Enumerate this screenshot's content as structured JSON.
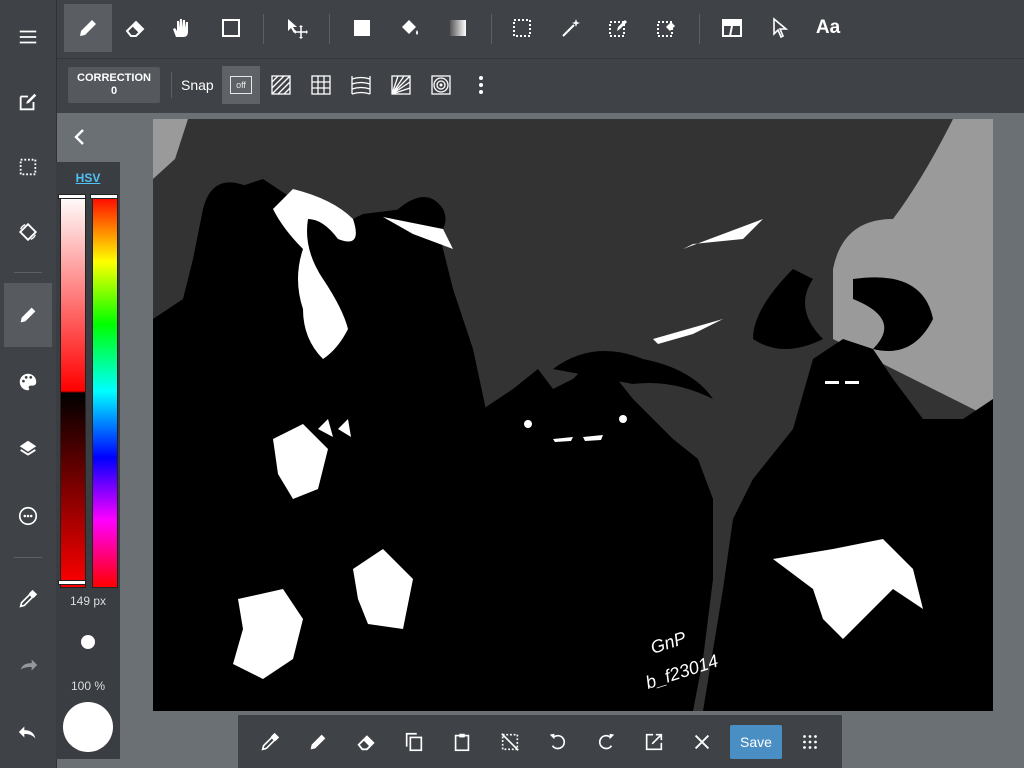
{
  "top_toolbar": {
    "tools": [
      "pen-icon",
      "eraser-icon",
      "hand-icon",
      "rectangle-shape-icon",
      "move-icon",
      "fill-rect-icon",
      "bucket-icon",
      "gradient-icon",
      "select-rect-icon",
      "magic-wand-icon",
      "select-pen-icon",
      "select-eraser-icon",
      "frame-icon",
      "pointer-icon",
      "text-icon"
    ],
    "text_tool_label": "Aa",
    "active_tool": "pen-icon"
  },
  "sub_toolbar": {
    "correction_label": "CORRECTION",
    "correction_value": "0",
    "snap_label": "Snap",
    "snap_off_label": "off",
    "snap_modes": [
      "parallel-lines-icon",
      "grid-icon",
      "curve-icon",
      "radial-icon",
      "concentric-icon",
      "more-icon"
    ]
  },
  "left_toolbar": {
    "items": [
      "menu-icon",
      "edit-icon",
      "selection-icon",
      "transform-icon",
      "brush-icon",
      "palette-icon",
      "layers-icon",
      "material-icon",
      "eyedropper-icon",
      "redo-icon",
      "undo-icon"
    ],
    "active": "brush-icon"
  },
  "color_panel": {
    "mode_label": "HSV",
    "brush_size": "149 px",
    "opacity": "100 %",
    "current_color": "#ffffff"
  },
  "canvas": {
    "background": "#333333",
    "signature_line1": "GnP",
    "signature_line2": "b_f23014"
  },
  "bottom_toolbar": {
    "items": [
      "eyedropper-icon",
      "pen-icon",
      "eraser-icon",
      "copy-icon",
      "paste-icon",
      "deselect-icon",
      "rotate-left-icon",
      "rotate-right-icon",
      "export-icon",
      "close-icon"
    ],
    "save_label": "Save",
    "grid_icon": "grid-dots-icon"
  },
  "colors": {
    "toolbar": "#3f4246",
    "accent": "#4a8fc4",
    "hsv_link": "#4fc3f7"
  }
}
